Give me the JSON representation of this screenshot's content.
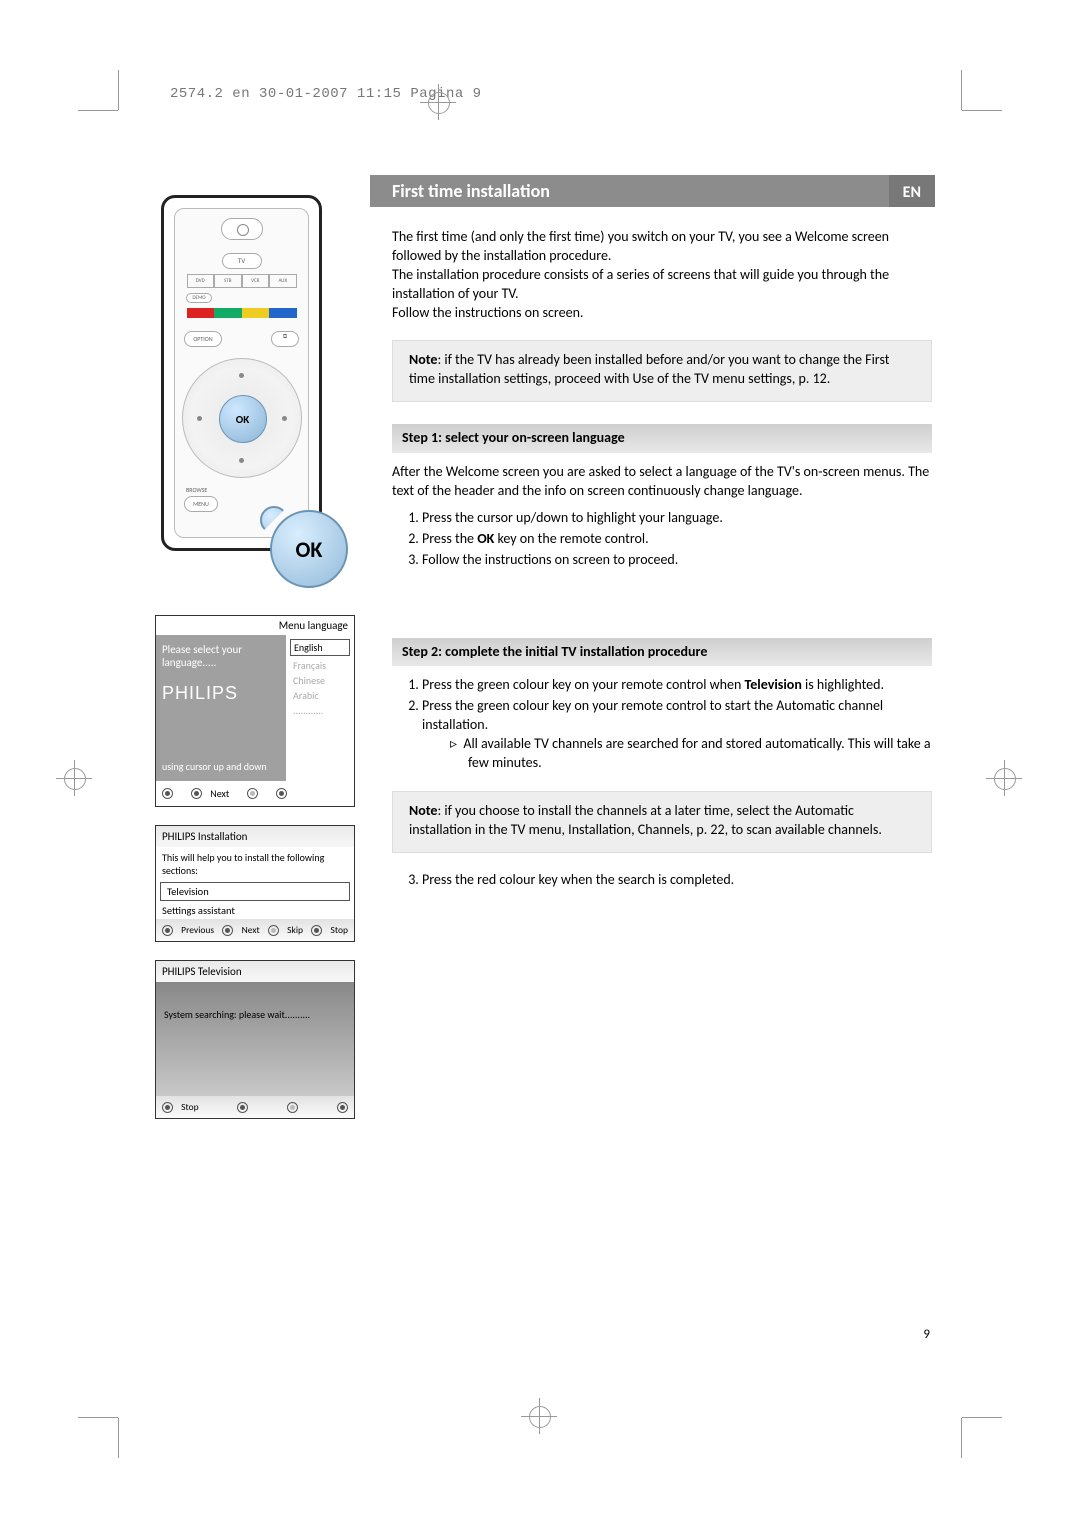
{
  "header_line": "2574.2 en  30-01-2007  11:15  Pagina 9",
  "title_bar": {
    "title": "First time installation",
    "lang": "EN"
  },
  "intro": {
    "p1": "The first time (and only the first time) you switch on your TV, you see a Welcome screen followed by the installation procedure.",
    "p2": "The installation procedure consists of a series of screens that will guide you through the installation of your TV.",
    "p3": "Follow the instructions on screen."
  },
  "note1_label": "Note",
  "note1": ": if the TV has already been installed before and/or you want to change the First time installation settings, proceed with Use of the TV menu settings, p. 12.",
  "step1": {
    "header": "Step 1: select your on-screen language",
    "p": "After the Welcome screen you are asked to select a language of the TV's on-screen menus. The text of the header and the info on screen continuously change language.",
    "li1": "Press the cursor up/down to highlight your language.",
    "li2a": "Press the ",
    "li2b": "OK",
    "li2c": " key on the remote control.",
    "li3": "Follow the instructions on screen to proceed."
  },
  "step2": {
    "header": "Step 2: complete the initial TV installation procedure",
    "li1a": "Press the green colour key on your remote control when ",
    "li1b": "Television",
    "li1c": " is highlighted.",
    "li2": "Press the green colour key on your remote control to start the Automatic channel installation.",
    "sub": "All available TV channels are searched for and stored automatically. This will take a few minutes.",
    "note_label": "Note",
    "note": ": if you choose to install the channels at a later time, select the Automatic installation in the TV menu, Installation, Channels, p. 22, to scan available channels.",
    "li3": "Press the red colour key when the search is completed."
  },
  "page_num": "9",
  "remote": {
    "tv": "TV",
    "dvd": "DVD",
    "stb": "STB",
    "vcr": "VCR",
    "aux": "AUX",
    "demo": "DEMO",
    "option": "OPTION",
    "ok": "OK",
    "browse": "BROWSE",
    "menu": "MENU"
  },
  "callout_ok": "OK",
  "osd_lang": {
    "top": "Menu language",
    "left_top": "Please select your language.....",
    "brand": "PHILIPS",
    "left_bottom": "using cursor up and down",
    "options": [
      "English",
      "Français",
      "Chinese",
      "Arabic",
      "............"
    ],
    "next": "Next"
  },
  "osd_install": {
    "hdr": "PHILIPS  Installation",
    "msg": "This will help you to install the following sections:",
    "item1": "Television",
    "item2": "Settings assistant",
    "f1": "Previous",
    "f2": "Next",
    "f3": "Skip",
    "f4": "Stop"
  },
  "osd_search": {
    "hdr": "PHILIPS  Television",
    "msg": "System searching: please wait..........",
    "f1": "Stop"
  }
}
